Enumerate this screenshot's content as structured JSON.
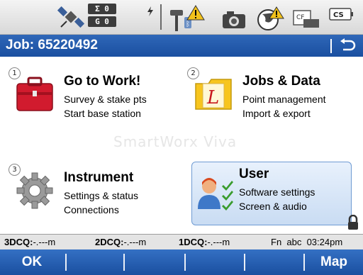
{
  "statusbar": {
    "sat_count_top": "Σ 0",
    "sat_count_bottom": "G 0",
    "cf_label": "CF",
    "cs_label": "CS"
  },
  "job": {
    "title": "Job: 65220492"
  },
  "tiles": [
    {
      "num": "1",
      "title": "Go to Work!",
      "line1": "Survey & stake pts",
      "line2": "Start base station",
      "icon": "briefcase-icon"
    },
    {
      "num": "2",
      "title": "Jobs & Data",
      "line1": "Point management",
      "line2": "Import & export",
      "icon": "folder-icon"
    },
    {
      "num": "3",
      "title": "Instrument",
      "line1": "Settings & status",
      "line2": "Connections",
      "icon": "gear-icon"
    },
    {
      "num": "",
      "title": "User",
      "line1": "Software settings",
      "line2": "Screen & audio",
      "icon": "user-icon"
    }
  ],
  "watermark": "SmartWorx Viva",
  "cq": {
    "q3_label": "3DCQ:",
    "q3_value": "-.---m",
    "q2_label": "2DCQ:",
    "q2_value": "-.---m",
    "q1_label": "1DCQ:",
    "q1_value": "-.---m",
    "fn": "Fn  abc  03:24pm"
  },
  "softkeys": {
    "f1": "OK",
    "f6": "Map"
  },
  "colors": {
    "accent": "#1a4fa0",
    "selected_tile": "#c9dcf3"
  }
}
